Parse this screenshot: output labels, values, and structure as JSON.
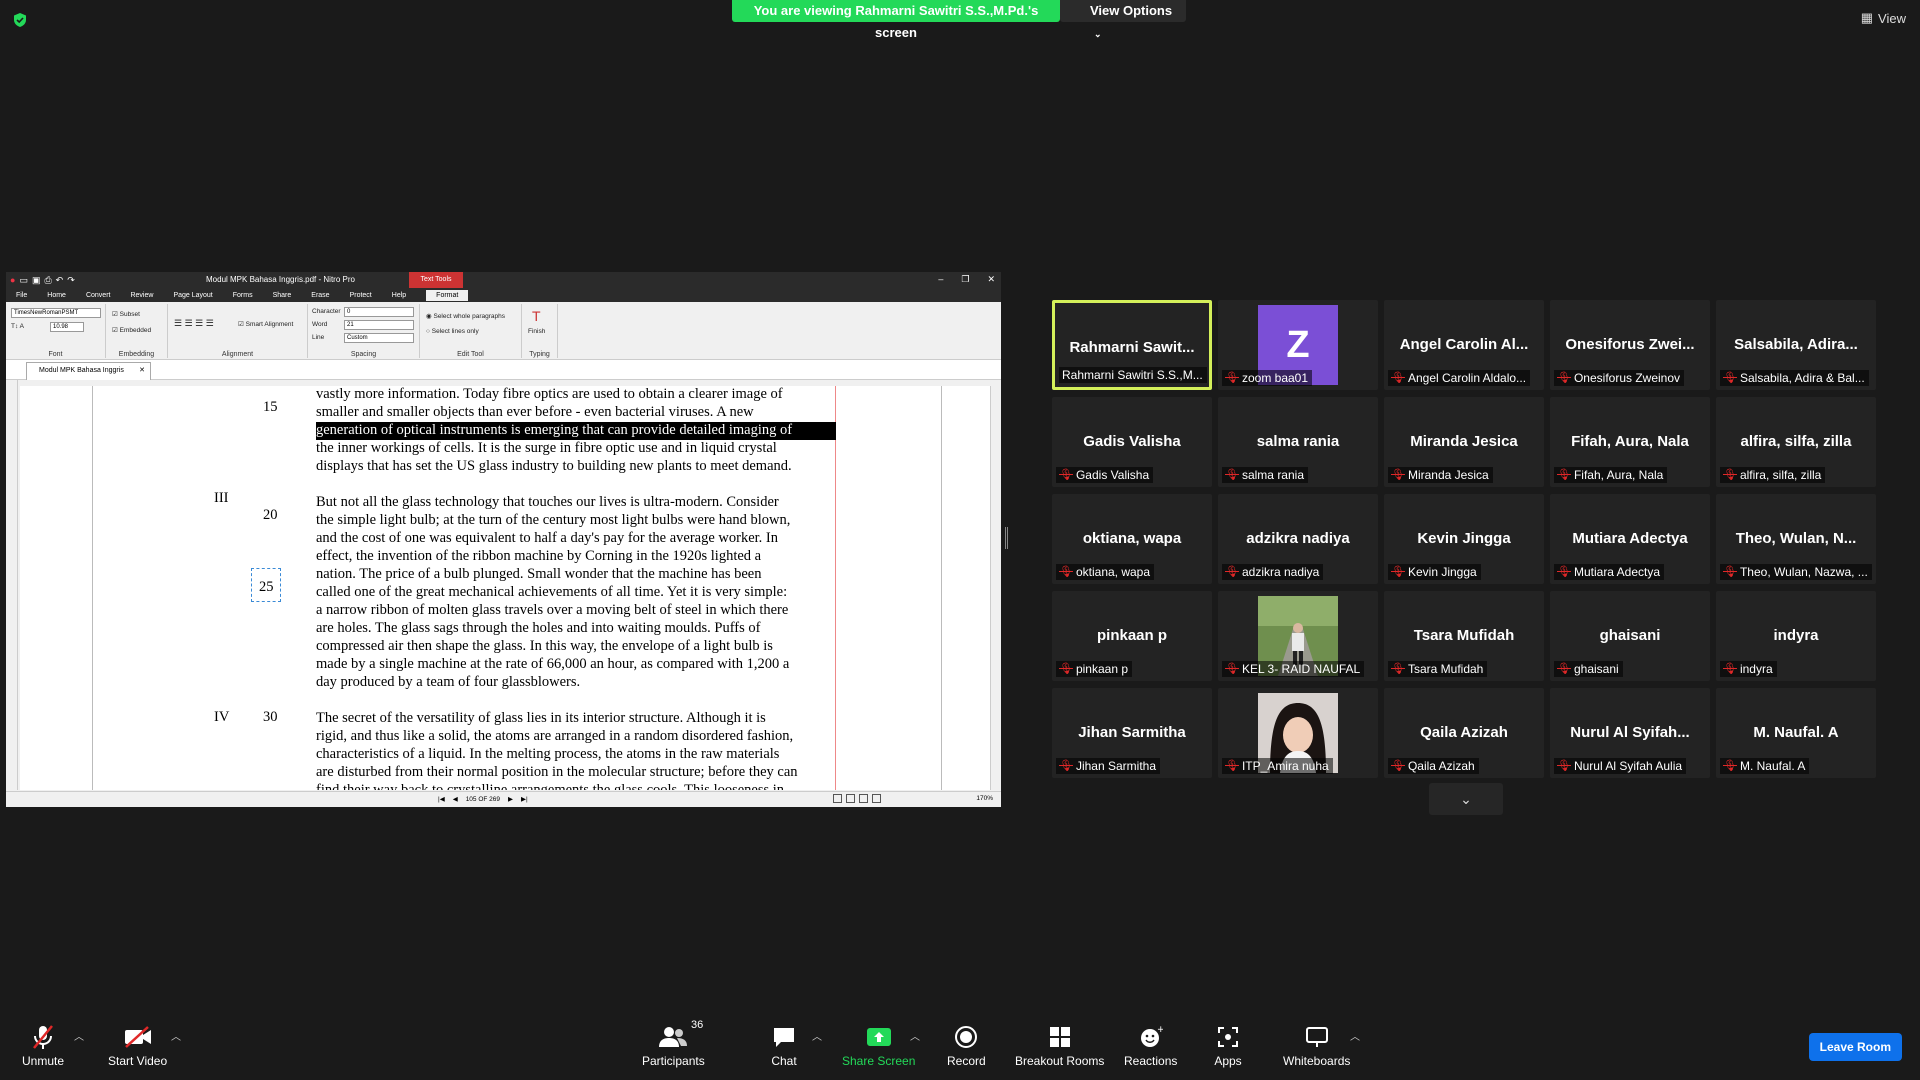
{
  "banner": {
    "sharing_text": "You are viewing Rahmarni Sawitri S.S.,M.Pd.'s screen",
    "view_options": "View Options"
  },
  "top_right": {
    "view_label": "View"
  },
  "nitro": {
    "title": "Modul MPK Bahasa Inggris.pdf - Nitro Pro",
    "context_tab": "Text Tools",
    "tabs": [
      "File",
      "Home",
      "Convert",
      "Review",
      "Page Layout",
      "Forms",
      "Share",
      "Erase",
      "Protect",
      "Help"
    ],
    "active_tab": "Format",
    "ribbon": {
      "font_name": "TimesNewRomanPSMT",
      "font_size": "10.98",
      "font_group": "Font",
      "subset": "Subset",
      "embedded": "Embedded",
      "embedding_group": "Embedding",
      "smart_alignment": "Smart Alignment",
      "alignment_group": "Alignment",
      "character_label": "Character",
      "character_value": "0",
      "word_label": "Word",
      "word_value": "21",
      "line_label": "Line",
      "line_value": "Custom",
      "spacing_group": "Spacing",
      "select_whole": "Select whole paragraphs",
      "select_lines": "Select lines only",
      "edit_tool_group": "Edit Tool",
      "finish": "Finish",
      "typing_group": "Typing"
    },
    "doc_tab": "Modul MPK Bahasa Inggris",
    "page_status": "105 OF 269",
    "zoom": "170%",
    "text_lines": [
      "vastly more information.  Today fibre optics are used to obtain a clearer image of",
      "smaller and smaller objects than ever before - even bacterial viruses.  A new",
      "generation of optical instruments is emerging that can provide detailed imaging of",
      "the inner workings of cells.  It is the surge in fibre optic use and in liquid crystal",
      "displays that has set the US glass industry to building new plants to meet demand.",
      "But not all the glass technology that touches our lives is ultra-modern.  Consider",
      "the simple light bulb; at the turn of the century most light bulbs were hand blown,",
      "and the cost of one was equivalent to half a day's pay for the average worker.  In",
      "effect, the invention of the ribbon machine by Corning in the 1920s lighted a",
      "nation.  The price of a bulb plunged.  Small wonder that the machine has been",
      "called one of the great mechanical achievements of all time.  Yet it is very simple:",
      "a narrow ribbon of molten glass travels over a moving belt of steel in which there",
      "are holes.  The glass sags through the holes and into waiting moulds.  Puffs of",
      "compressed air then shape the glass.  In this way, the envelope of a light bulb is",
      "made by a single machine at the rate of 66,000 an hour, as compared with 1,200 a",
      "day produced by a team of four glassblowers.",
      "The secret of the versatility of glass lies in its interior structure.  Although it is",
      "rigid, and thus like a solid, the atoms are arranged in a random disordered fashion,",
      "characteristics of a liquid.  In the melting process, the atoms in the raw materials",
      "are disturbed from their normal position in the molecular structure; before they can",
      "find their way back to crystalline arrangements the glass cools.  This looseness in"
    ],
    "line_numbers": [
      "15",
      "20",
      "25",
      "30"
    ],
    "section_numbers": [
      "III",
      "IV"
    ]
  },
  "participants": [
    {
      "big": "Rahmarni  Sawit...",
      "label": "Rahmarni Sawitri S.S.,M...",
      "muted": false,
      "active": true
    },
    {
      "big": "",
      "label": "zoom baa01",
      "muted": true,
      "avatar": "Z"
    },
    {
      "big": "Angel  Carolin  Al...",
      "label": "Angel Carolin Aldalo...",
      "muted": true
    },
    {
      "big": "Onesiforus  Zwei...",
      "label": "Onesiforus Zweinov",
      "muted": true
    },
    {
      "big": "Salsabila,  Adira...",
      "label": "Salsabila, Adira & Bal...",
      "muted": true
    },
    {
      "big": "Gadis Valisha",
      "label": "Gadis Valisha",
      "muted": true
    },
    {
      "big": "salma rania",
      "label": "salma rania",
      "muted": true
    },
    {
      "big": "Miranda Jesica",
      "label": "Miranda Jesica",
      "muted": true
    },
    {
      "big": "Fifah, Aura, Nala",
      "label": "Fifah, Aura, Nala",
      "muted": true
    },
    {
      "big": "alfira, silfa, zilla",
      "label": "alfira, silfa, zilla",
      "muted": true
    },
    {
      "big": "oktiana, wapa",
      "label": "oktiana, wapa",
      "muted": true
    },
    {
      "big": "adzikra nadiya",
      "label": "adzikra nadiya",
      "muted": true
    },
    {
      "big": "Kevin Jingga",
      "label": "Kevin Jingga",
      "muted": true
    },
    {
      "big": "Mutiara Adectya",
      "label": "Mutiara Adectya",
      "muted": true
    },
    {
      "big": "Theo,  Wulan,  N...",
      "label": "Theo, Wulan, Nazwa, ...",
      "muted": true
    },
    {
      "big": "pinkaan p",
      "label": "pinkaan p",
      "muted": true
    },
    {
      "big": "",
      "label": "KEL 3- RAID NAUFAL",
      "muted": true,
      "photo": "outdoor"
    },
    {
      "big": "Tsara Mufidah",
      "label": "Tsara Mufidah",
      "muted": true
    },
    {
      "big": "ghaisani",
      "label": "ghaisani",
      "muted": true
    },
    {
      "big": "indyra",
      "label": "indyra",
      "muted": true
    },
    {
      "big": "Jihan Sarmitha",
      "label": "Jihan Sarmitha",
      "muted": true
    },
    {
      "big": "",
      "label": "ITP_Amira nuha",
      "muted": true,
      "photo": "portrait"
    },
    {
      "big": "Qaila Azizah",
      "label": "Qaila Azizah",
      "muted": true
    },
    {
      "big": "Nurul  Al  Syifah...",
      "label": "Nurul Al Syifah Aulia",
      "muted": true
    },
    {
      "big": "M.  Naufal.  A",
      "label": "M. Naufal. A",
      "muted": true
    }
  ],
  "toolbar": {
    "unmute": "Unmute",
    "start_video": "Start Video",
    "participants": "Participants",
    "participants_count": "36",
    "chat": "Chat",
    "share_screen": "Share Screen",
    "record": "Record",
    "breakout": "Breakout Rooms",
    "reactions": "Reactions",
    "apps": "Apps",
    "whiteboards": "Whiteboards",
    "leave": "Leave Room"
  },
  "colors": {
    "share_green": "#23d959",
    "leave_blue": "#0e71eb",
    "active_border": "#d4f05a",
    "mute_red": "#e02828"
  }
}
